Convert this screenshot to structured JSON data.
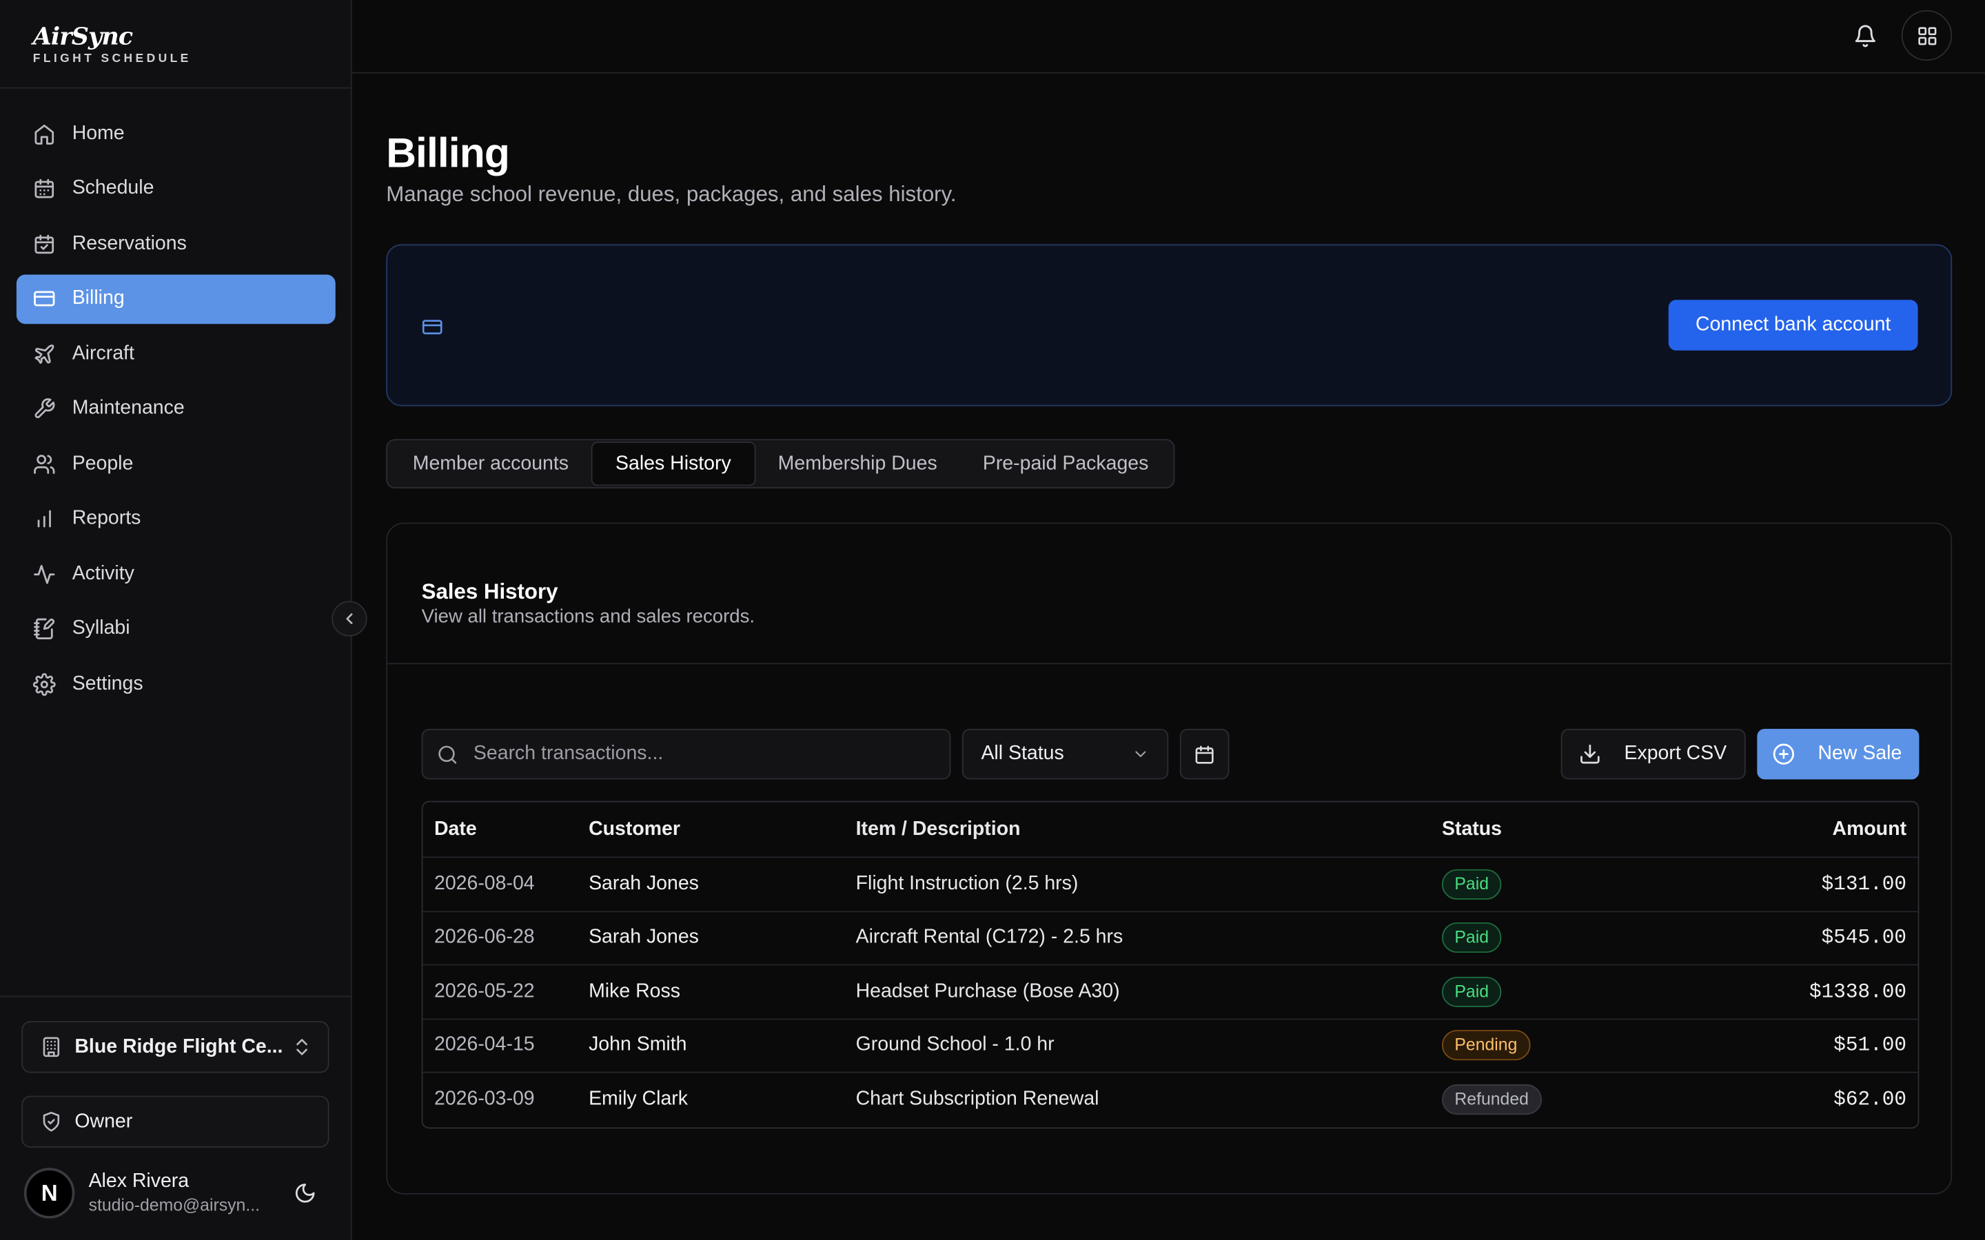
{
  "brand": {
    "name": "AirSync",
    "subtitle": "FLIGHT SCHEDULE"
  },
  "sidebar": {
    "items": [
      {
        "label": "Home",
        "icon": "home-icon"
      },
      {
        "label": "Schedule",
        "icon": "calendar-icon"
      },
      {
        "label": "Reservations",
        "icon": "calendar-check-icon"
      },
      {
        "label": "Billing",
        "icon": "credit-card-icon",
        "active": true
      },
      {
        "label": "Aircraft",
        "icon": "plane-icon"
      },
      {
        "label": "Maintenance",
        "icon": "wrench-icon"
      },
      {
        "label": "People",
        "icon": "users-icon"
      },
      {
        "label": "Reports",
        "icon": "bar-chart-icon"
      },
      {
        "label": "Activity",
        "icon": "activity-icon"
      },
      {
        "label": "Syllabi",
        "icon": "notebook-icon"
      },
      {
        "label": "Settings",
        "icon": "gear-icon"
      }
    ],
    "org": "Blue Ridge Flight Ce...",
    "role": "Owner",
    "user": {
      "name": "Alex Rivera",
      "email": "studio-demo@airsyn...",
      "initial": "N"
    }
  },
  "page": {
    "title": "Billing",
    "subtitle": "Manage school revenue, dues, packages, and sales history."
  },
  "banner": {
    "button": "Connect bank account"
  },
  "tabs": [
    {
      "label": "Member accounts"
    },
    {
      "label": "Sales History",
      "active": true
    },
    {
      "label": "Membership Dues"
    },
    {
      "label": "Pre-paid Packages"
    }
  ],
  "sales": {
    "title": "Sales History",
    "subtitle": "View all transactions and sales records.",
    "search_placeholder": "Search transactions...",
    "status_filter": "All Status",
    "export_label": "Export CSV",
    "new_sale_label": "New Sale",
    "columns": [
      "Date",
      "Customer",
      "Item / Description",
      "Status",
      "Amount"
    ],
    "rows": [
      {
        "date": "2026-08-04",
        "customer": "Sarah Jones",
        "item": "Flight Instruction (2.5 hrs)",
        "status": "Paid",
        "amount": "$131.00"
      },
      {
        "date": "2026-06-28",
        "customer": "Sarah Jones",
        "item": "Aircraft Rental (C172) - 2.5 hrs",
        "status": "Paid",
        "amount": "$545.00"
      },
      {
        "date": "2026-05-22",
        "customer": "Mike Ross",
        "item": "Headset Purchase (Bose A30)",
        "status": "Paid",
        "amount": "$1338.00"
      },
      {
        "date": "2026-04-15",
        "customer": "John Smith",
        "item": "Ground School - 1.0 hr",
        "status": "Pending",
        "amount": "$51.00"
      },
      {
        "date": "2026-03-09",
        "customer": "Emily Clark",
        "item": "Chart Subscription Renewal",
        "status": "Refunded",
        "amount": "$62.00"
      }
    ]
  },
  "colors": {
    "accent": "#5c93e6",
    "primary_button": "#2463eb",
    "background": "#0a0a0b"
  }
}
